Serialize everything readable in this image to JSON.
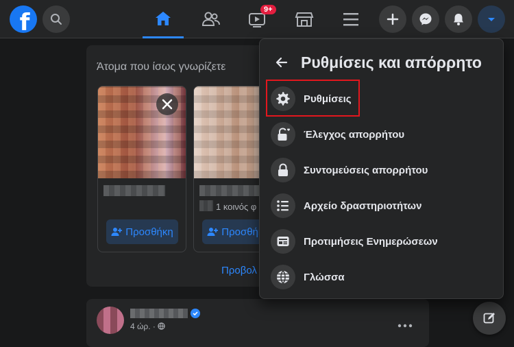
{
  "topbar": {
    "logo_letter": "f",
    "notifications_badge": "9+",
    "colors": {
      "bar": "#242526",
      "accent": "#2d88ff",
      "badge": "#e41e3f"
    }
  },
  "feed": {
    "pymk_title": "Άτομα που ίσως γνωρίζετε",
    "cards": [
      {
        "mutual_friends": "",
        "add_label": "Προσθήκη"
      },
      {
        "mutual_friends": "1 κοινός φ",
        "add_label": "Προσθήκη"
      }
    ],
    "see_all_label": "Προβολ",
    "post": {
      "time": "4 ώρ. · "
    }
  },
  "menu": {
    "title": "Ρυθμίσεις και απόρρητο",
    "items": [
      {
        "label": "Ρυθμίσεις",
        "icon": "gear-icon"
      },
      {
        "label": "Έλεγχος απορρήτου",
        "icon": "lock-heart-icon"
      },
      {
        "label": "Συντομεύσεις απορρήτου",
        "icon": "lock-icon"
      },
      {
        "label": "Αρχείο δραστηριοτήτων",
        "icon": "list-icon"
      },
      {
        "label": "Προτιμήσεις Ενημερώσεων",
        "icon": "news-feed-icon"
      },
      {
        "label": "Γλώσσα",
        "icon": "globe-icon"
      }
    ]
  }
}
